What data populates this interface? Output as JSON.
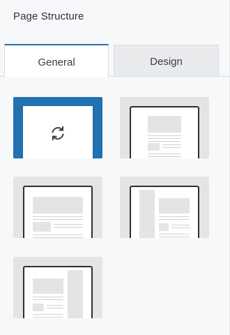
{
  "panel": {
    "title": "Page Structure"
  },
  "tabs": [
    {
      "label": "General",
      "active": true
    },
    {
      "label": "Design",
      "active": false
    }
  ],
  "layouts": [
    {
      "name": "loading",
      "selected": true,
      "icon": "refresh-icon"
    },
    {
      "name": "full-width-content",
      "selected": false
    },
    {
      "name": "no-sidebar",
      "selected": false
    },
    {
      "name": "left-sidebar",
      "selected": false
    },
    {
      "name": "right-sidebar",
      "selected": false
    }
  ],
  "colors": {
    "accent": "#2271b1",
    "tile_bg": "#e3e4e6",
    "page_border": "#2c2f33"
  }
}
